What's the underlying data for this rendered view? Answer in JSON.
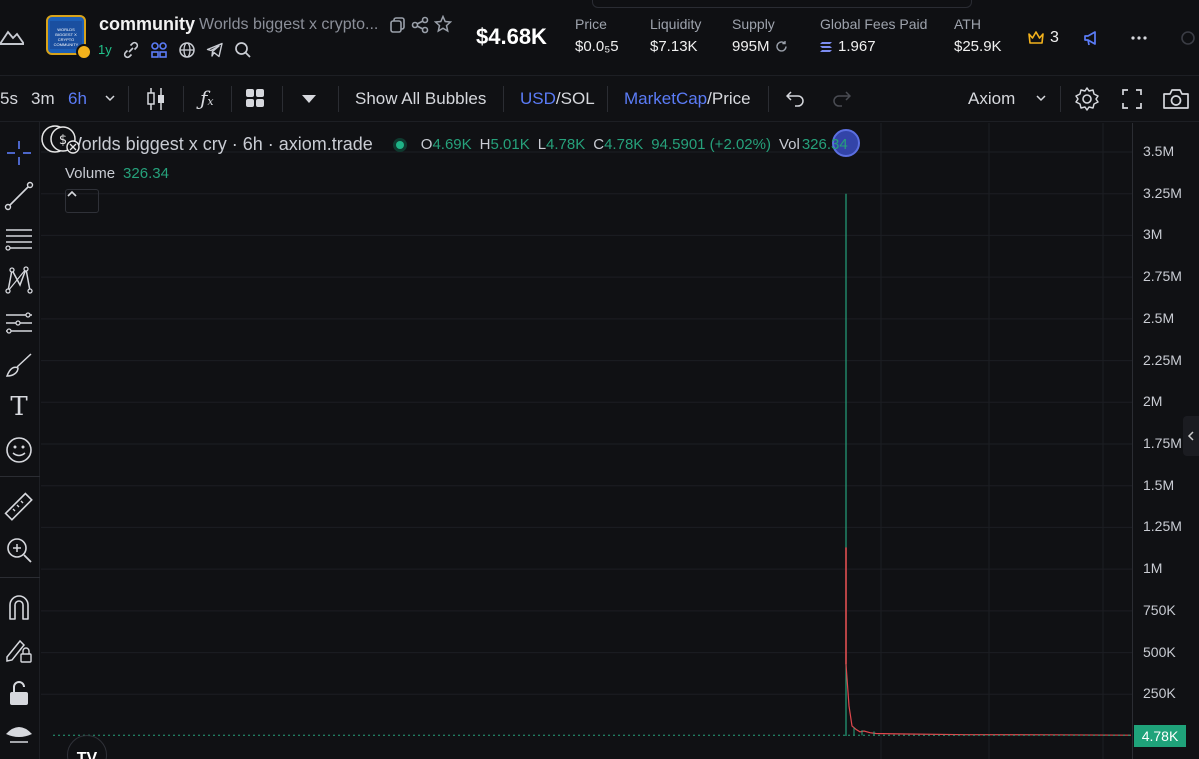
{
  "header": {
    "token_symbol": "community",
    "token_fullname": "Worlds biggest x crypto...",
    "logo_text": "WORLDS BIGGEST X CRYPTO COMMUNITY",
    "age": "1y",
    "market_cap": "$4.68K",
    "stats": [
      {
        "label": "Price",
        "value": "$0.0₅5"
      },
      {
        "label": "Liquidity",
        "value": "$7.13K"
      },
      {
        "label": "Supply",
        "value": "995M"
      },
      {
        "label": "Global Fees Paid",
        "value": "1.967"
      },
      {
        "label": "ATH",
        "value": "$25.9K"
      }
    ],
    "crown_count": "3",
    "icons": [
      "copy-icon",
      "share-icon",
      "star-icon",
      "link-icon",
      "bubbles-icon",
      "globe-icon",
      "telegram-icon",
      "search-icon",
      "refresh-icon",
      "solana-icon",
      "crown-icon",
      "megaphone-icon",
      "more-icon"
    ]
  },
  "toolbar": {
    "timeframes": [
      "5s",
      "3m",
      "6h"
    ],
    "active_timeframe": "6h",
    "show_all_bubbles": "Show All Bubbles",
    "currency_primary": "USD",
    "currency_secondary": "/SOL",
    "metric_primary": "MarketCap",
    "metric_secondary": "/Price",
    "source": "Axiom"
  },
  "chart": {
    "legend_title": "Worlds biggest x cry · 6h · axiom.trade",
    "ohlc": {
      "o_label": "O",
      "o": "4.69K",
      "h_label": "H",
      "h": "5.01K",
      "l_label": "L",
      "l": "4.78K",
      "c_label": "C",
      "c": "4.78K",
      "change": "94.5901 (+2.02%)",
      "vol_label": "Vol",
      "vol": "326.34"
    },
    "volume_label": "Volume",
    "volume_value": "326.34",
    "tv_logo": "TV"
  },
  "axis": {
    "ticks": [
      "3.5M",
      "3.25M",
      "3M",
      "2.75M",
      "2.5M",
      "2.25M",
      "2M",
      "1.75M",
      "1.5M",
      "1.25M",
      "1M",
      "750K",
      "500K",
      "250K"
    ],
    "last_price": "4.78K"
  },
  "chart_data": {
    "type": "line",
    "ylim": [
      0,
      3500000
    ],
    "ohlc": {
      "open": 4690,
      "high": 5010,
      "low": 4780,
      "close": 4780
    },
    "spike": {
      "max": 3250000,
      "secondary": 1130000,
      "tertiary": 430000
    },
    "last_price": 4780
  },
  "colors": {
    "accent": "#5b7cf7",
    "green": "#26a17b",
    "red": "#e0474c",
    "background": "#101114"
  }
}
